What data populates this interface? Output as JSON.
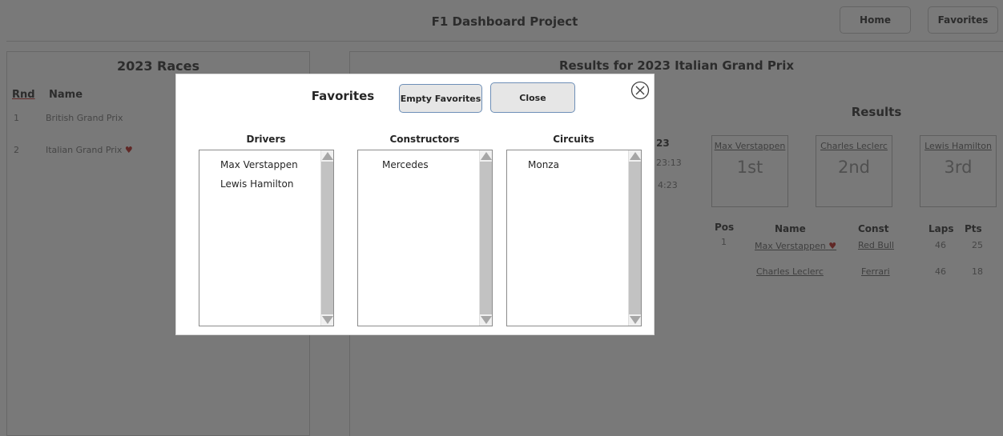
{
  "header": {
    "title": "F1 Dashboard Project",
    "nav": {
      "home": "Home",
      "favorites": "Favorites"
    }
  },
  "races": {
    "title": "2023 Races",
    "columns": {
      "rnd": "Rnd",
      "name": "Name"
    },
    "rows": [
      {
        "rnd": "1",
        "name": "British Grand Prix",
        "favorite": false
      },
      {
        "rnd": "2",
        "name": "Italian Grand Prix",
        "favorite": true
      }
    ]
  },
  "results": {
    "title": "Results for 2023 Italian Grand Prix",
    "subtitle": "Results",
    "fragments": {
      "col_header": "23",
      "time1": "23:13",
      "time2": "4:23"
    },
    "podium": [
      {
        "name": "Max Verstappen",
        "place": "1st"
      },
      {
        "name": "Charles Leclerc",
        "place": "2nd"
      },
      {
        "name": "Lewis Hamilton",
        "place": "3rd"
      }
    ],
    "columns": {
      "pos": "Pos",
      "name": "Name",
      "const": "Const",
      "laps": "Laps",
      "pts": "Pts"
    },
    "rows": [
      {
        "pos": "1",
        "name": "Max Verstappen",
        "favorite": true,
        "const": "Red Bull",
        "laps": "46",
        "pts": "25"
      },
      {
        "pos": "",
        "name": "Charles Leclerc",
        "favorite": false,
        "const": "Ferrari",
        "laps": "46",
        "pts": "18"
      }
    ]
  },
  "modal": {
    "title": "Favorites",
    "empty_button": "Empty Favorites",
    "close_button": "Close",
    "lists": {
      "drivers": {
        "label": "Drivers",
        "items": [
          "Max Verstappen",
          "Lewis Hamilton"
        ]
      },
      "constructors": {
        "label": "Constructors",
        "items": [
          "Mercedes"
        ]
      },
      "circuits": {
        "label": "Circuits",
        "items": [
          "Monza"
        ]
      }
    }
  },
  "colors": {
    "heart": "#c0504d",
    "button_border": "#6e8fb7",
    "overlay": "rgba(0,0,0,0.5)"
  },
  "icons": {
    "close": "circle-x-icon",
    "favorite": "heart-icon",
    "scroll_up": "arrow-up-icon",
    "scroll_down": "arrow-down-icon"
  }
}
